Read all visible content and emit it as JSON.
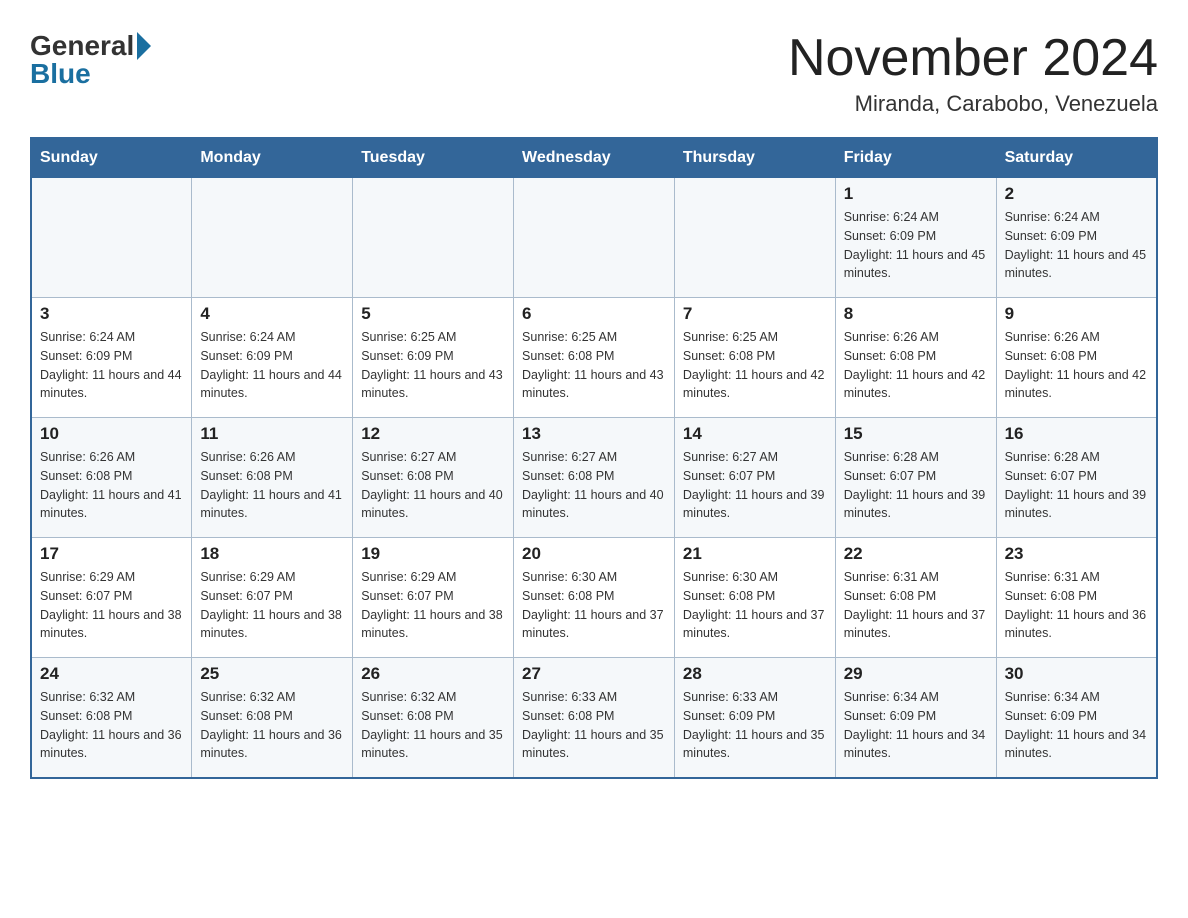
{
  "logo": {
    "general": "General",
    "blue": "Blue"
  },
  "title": "November 2024",
  "subtitle": "Miranda, Carabobo, Venezuela",
  "days_of_week": [
    "Sunday",
    "Monday",
    "Tuesday",
    "Wednesday",
    "Thursday",
    "Friday",
    "Saturday"
  ],
  "weeks": [
    [
      {
        "day": "",
        "info": ""
      },
      {
        "day": "",
        "info": ""
      },
      {
        "day": "",
        "info": ""
      },
      {
        "day": "",
        "info": ""
      },
      {
        "day": "",
        "info": ""
      },
      {
        "day": "1",
        "info": "Sunrise: 6:24 AM\nSunset: 6:09 PM\nDaylight: 11 hours and 45 minutes."
      },
      {
        "day": "2",
        "info": "Sunrise: 6:24 AM\nSunset: 6:09 PM\nDaylight: 11 hours and 45 minutes."
      }
    ],
    [
      {
        "day": "3",
        "info": "Sunrise: 6:24 AM\nSunset: 6:09 PM\nDaylight: 11 hours and 44 minutes."
      },
      {
        "day": "4",
        "info": "Sunrise: 6:24 AM\nSunset: 6:09 PM\nDaylight: 11 hours and 44 minutes."
      },
      {
        "day": "5",
        "info": "Sunrise: 6:25 AM\nSunset: 6:09 PM\nDaylight: 11 hours and 43 minutes."
      },
      {
        "day": "6",
        "info": "Sunrise: 6:25 AM\nSunset: 6:08 PM\nDaylight: 11 hours and 43 minutes."
      },
      {
        "day": "7",
        "info": "Sunrise: 6:25 AM\nSunset: 6:08 PM\nDaylight: 11 hours and 42 minutes."
      },
      {
        "day": "8",
        "info": "Sunrise: 6:26 AM\nSunset: 6:08 PM\nDaylight: 11 hours and 42 minutes."
      },
      {
        "day": "9",
        "info": "Sunrise: 6:26 AM\nSunset: 6:08 PM\nDaylight: 11 hours and 42 minutes."
      }
    ],
    [
      {
        "day": "10",
        "info": "Sunrise: 6:26 AM\nSunset: 6:08 PM\nDaylight: 11 hours and 41 minutes."
      },
      {
        "day": "11",
        "info": "Sunrise: 6:26 AM\nSunset: 6:08 PM\nDaylight: 11 hours and 41 minutes."
      },
      {
        "day": "12",
        "info": "Sunrise: 6:27 AM\nSunset: 6:08 PM\nDaylight: 11 hours and 40 minutes."
      },
      {
        "day": "13",
        "info": "Sunrise: 6:27 AM\nSunset: 6:08 PM\nDaylight: 11 hours and 40 minutes."
      },
      {
        "day": "14",
        "info": "Sunrise: 6:27 AM\nSunset: 6:07 PM\nDaylight: 11 hours and 39 minutes."
      },
      {
        "day": "15",
        "info": "Sunrise: 6:28 AM\nSunset: 6:07 PM\nDaylight: 11 hours and 39 minutes."
      },
      {
        "day": "16",
        "info": "Sunrise: 6:28 AM\nSunset: 6:07 PM\nDaylight: 11 hours and 39 minutes."
      }
    ],
    [
      {
        "day": "17",
        "info": "Sunrise: 6:29 AM\nSunset: 6:07 PM\nDaylight: 11 hours and 38 minutes."
      },
      {
        "day": "18",
        "info": "Sunrise: 6:29 AM\nSunset: 6:07 PM\nDaylight: 11 hours and 38 minutes."
      },
      {
        "day": "19",
        "info": "Sunrise: 6:29 AM\nSunset: 6:07 PM\nDaylight: 11 hours and 38 minutes."
      },
      {
        "day": "20",
        "info": "Sunrise: 6:30 AM\nSunset: 6:08 PM\nDaylight: 11 hours and 37 minutes."
      },
      {
        "day": "21",
        "info": "Sunrise: 6:30 AM\nSunset: 6:08 PM\nDaylight: 11 hours and 37 minutes."
      },
      {
        "day": "22",
        "info": "Sunrise: 6:31 AM\nSunset: 6:08 PM\nDaylight: 11 hours and 37 minutes."
      },
      {
        "day": "23",
        "info": "Sunrise: 6:31 AM\nSunset: 6:08 PM\nDaylight: 11 hours and 36 minutes."
      }
    ],
    [
      {
        "day": "24",
        "info": "Sunrise: 6:32 AM\nSunset: 6:08 PM\nDaylight: 11 hours and 36 minutes."
      },
      {
        "day": "25",
        "info": "Sunrise: 6:32 AM\nSunset: 6:08 PM\nDaylight: 11 hours and 36 minutes."
      },
      {
        "day": "26",
        "info": "Sunrise: 6:32 AM\nSunset: 6:08 PM\nDaylight: 11 hours and 35 minutes."
      },
      {
        "day": "27",
        "info": "Sunrise: 6:33 AM\nSunset: 6:08 PM\nDaylight: 11 hours and 35 minutes."
      },
      {
        "day": "28",
        "info": "Sunrise: 6:33 AM\nSunset: 6:09 PM\nDaylight: 11 hours and 35 minutes."
      },
      {
        "day": "29",
        "info": "Sunrise: 6:34 AM\nSunset: 6:09 PM\nDaylight: 11 hours and 34 minutes."
      },
      {
        "day": "30",
        "info": "Sunrise: 6:34 AM\nSunset: 6:09 PM\nDaylight: 11 hours and 34 minutes."
      }
    ]
  ]
}
